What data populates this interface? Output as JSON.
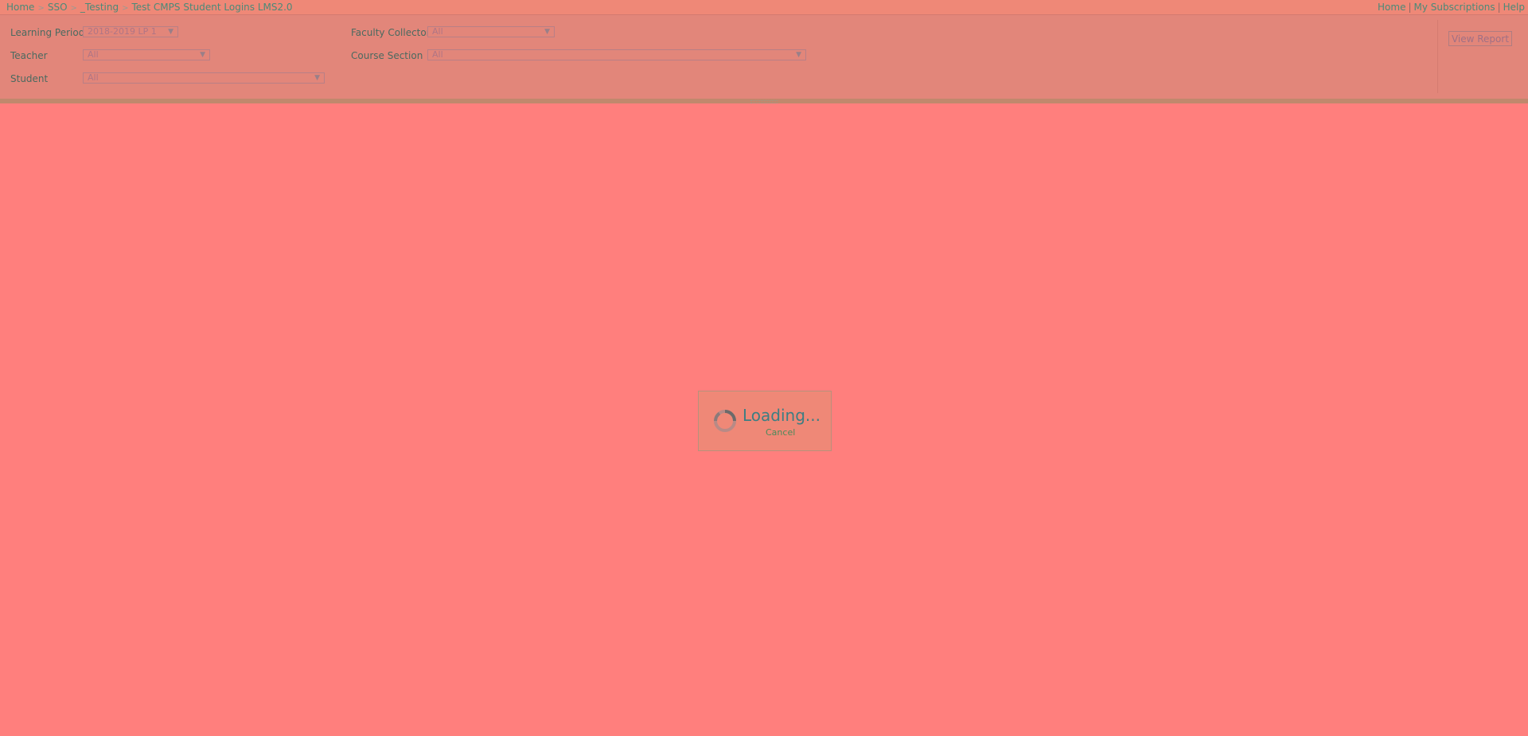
{
  "breadcrumb": {
    "items": [
      "Home",
      "SSO",
      "_Testing",
      "Test CMPS Student Logins LMS2.0"
    ],
    "separator": ">"
  },
  "top_links": {
    "home": "Home",
    "subscriptions": "My Subscriptions",
    "help": "Help",
    "separator": "|"
  },
  "parameters": {
    "learning_period": {
      "label": "Learning Period",
      "value": "2018-2019 LP 1"
    },
    "teacher": {
      "label": "Teacher",
      "value": "All"
    },
    "student": {
      "label": "Student",
      "value": "All"
    },
    "faculty_collector": {
      "label": "Faculty Collector",
      "value": "All"
    },
    "course_section": {
      "label": "Course Section",
      "value": "All"
    }
  },
  "view_report_label": "View Report",
  "loading": {
    "text": "Loading...",
    "cancel": "Cancel"
  },
  "icons": {
    "dropdown_arrow": "▼"
  },
  "colors": {
    "background": "#ff7f7d",
    "param_panel": "#e2867a",
    "link": "#4a8a78",
    "loading_text": "#3c7e83"
  }
}
